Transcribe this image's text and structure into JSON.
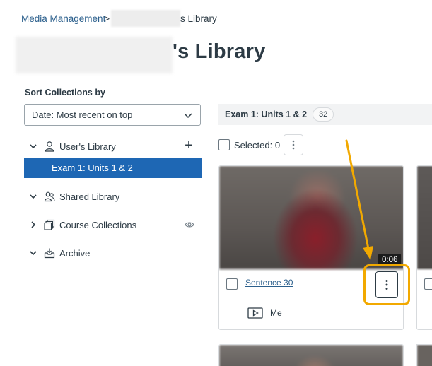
{
  "breadcrumb": {
    "root": "Media Management",
    "separator": ">",
    "current_tail": "s Library"
  },
  "page_title": {
    "tail": "'s Library"
  },
  "sort": {
    "label": "Sort Collections by",
    "selected": "Date: Most recent on top"
  },
  "tree": {
    "users_library": "User's Library",
    "selected_collection": "Exam 1: Units 1 & 2",
    "shared_library": "Shared Library",
    "course_collections": "Course Collections",
    "archive": "Archive"
  },
  "collection": {
    "title": "Exam 1: Units 1 & 2",
    "count": "32",
    "selected_label": "Selected: 0"
  },
  "media_card": {
    "title": "Sentence 30",
    "duration": "0:06",
    "owner": "Me"
  },
  "colors": {
    "accent_blue": "#1e67b4",
    "link_blue": "#2b5f8c",
    "highlight_orange": "#f2a900",
    "text": "#2d3b45"
  },
  "icons": {
    "user": "user-icon",
    "shared": "users-icon",
    "course": "collections-icon",
    "archive": "archive-icon",
    "media": "play-icon",
    "kebab": "more-vertical-icon"
  }
}
